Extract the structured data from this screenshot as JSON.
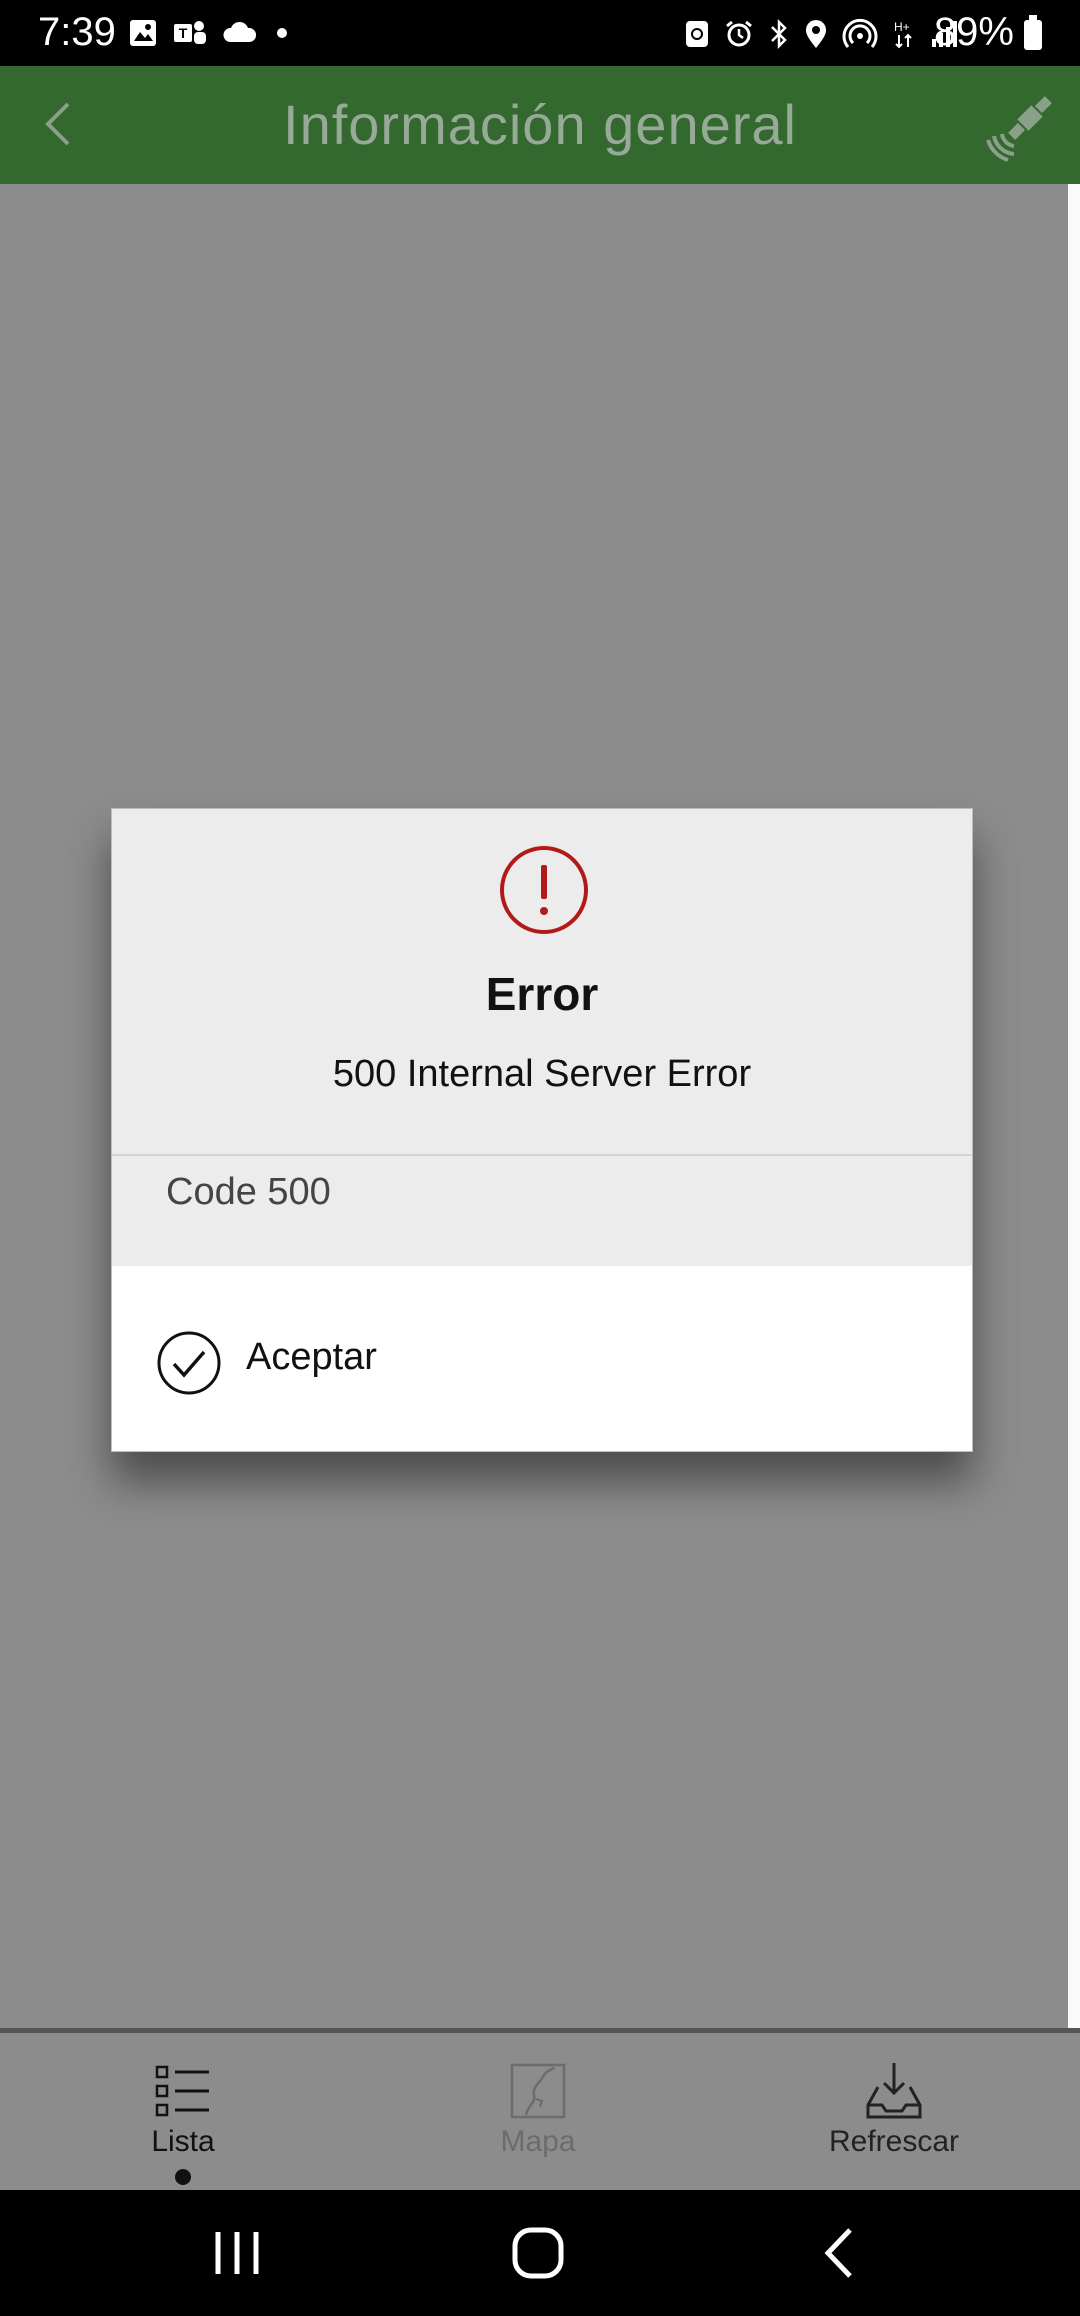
{
  "status_bar": {
    "time": "7:39",
    "battery": "89%",
    "left_icons": [
      "gallery-icon",
      "teams-icon",
      "cloud-icon",
      "dot-icon"
    ],
    "right_icons": [
      "nfc-icon",
      "alarm-icon",
      "bluetooth-icon",
      "location-icon",
      "hotspot-icon",
      "hplus-icon",
      "signal-icon"
    ]
  },
  "app_bar": {
    "title": "Información general",
    "back_icon": "chevron-left-icon",
    "action_icon": "satellite-icon"
  },
  "dialog": {
    "icon": "alert-circle-icon",
    "title": "Error",
    "message": "500 Internal Server Error",
    "code": "Code 500",
    "accept_label": "Aceptar",
    "accent_color": "#b21a1a"
  },
  "bottom_nav": {
    "items": [
      {
        "label": "Lista",
        "icon": "list-icon",
        "active": true
      },
      {
        "label": "Mapa",
        "icon": "map-icon",
        "active": false
      },
      {
        "label": "Refrescar",
        "icon": "download-tray-icon",
        "active": false
      }
    ]
  },
  "system_nav": {
    "buttons": [
      "recent-apps-icon",
      "home-icon",
      "back-icon"
    ]
  },
  "colors": {
    "app_bar": "#33682f",
    "scrim": "#8c8c8c"
  }
}
